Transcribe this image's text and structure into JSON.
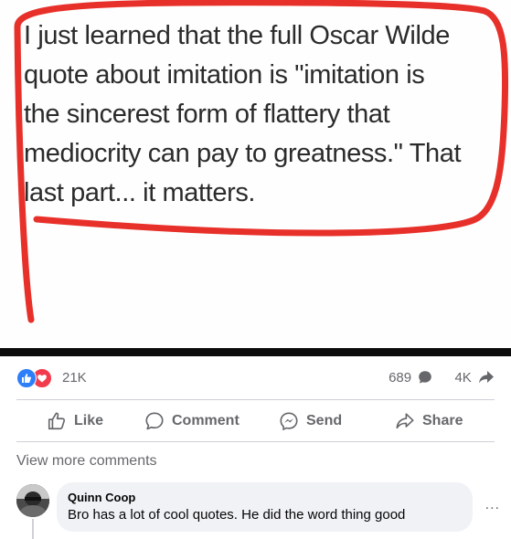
{
  "post": {
    "quote_lines": [
      "I just learned that the full Oscar Wilde",
      "quote about imitation is \"imitation is",
      "the sincerest form of flattery that",
      "mediocrity can pay to greatness.\" That",
      "last part... it matters."
    ]
  },
  "reactions": {
    "total": "21K",
    "comments_count": "689",
    "shares_count": "4K"
  },
  "actions": {
    "like": "Like",
    "comment": "Comment",
    "send": "Send",
    "share": "Share"
  },
  "comments": {
    "view_more": "View more comments",
    "items": [
      {
        "author": "Quinn Coop",
        "text": "Bro has a lot of cool quotes. He did the word thing good",
        "more": "..."
      }
    ]
  },
  "colors": {
    "like_blue": "#2d7ff9",
    "love_red": "#f23b4d",
    "marker_red": "#e8302a",
    "secondary_text": "#65676b",
    "bubble_bg": "#f0f2f5"
  }
}
